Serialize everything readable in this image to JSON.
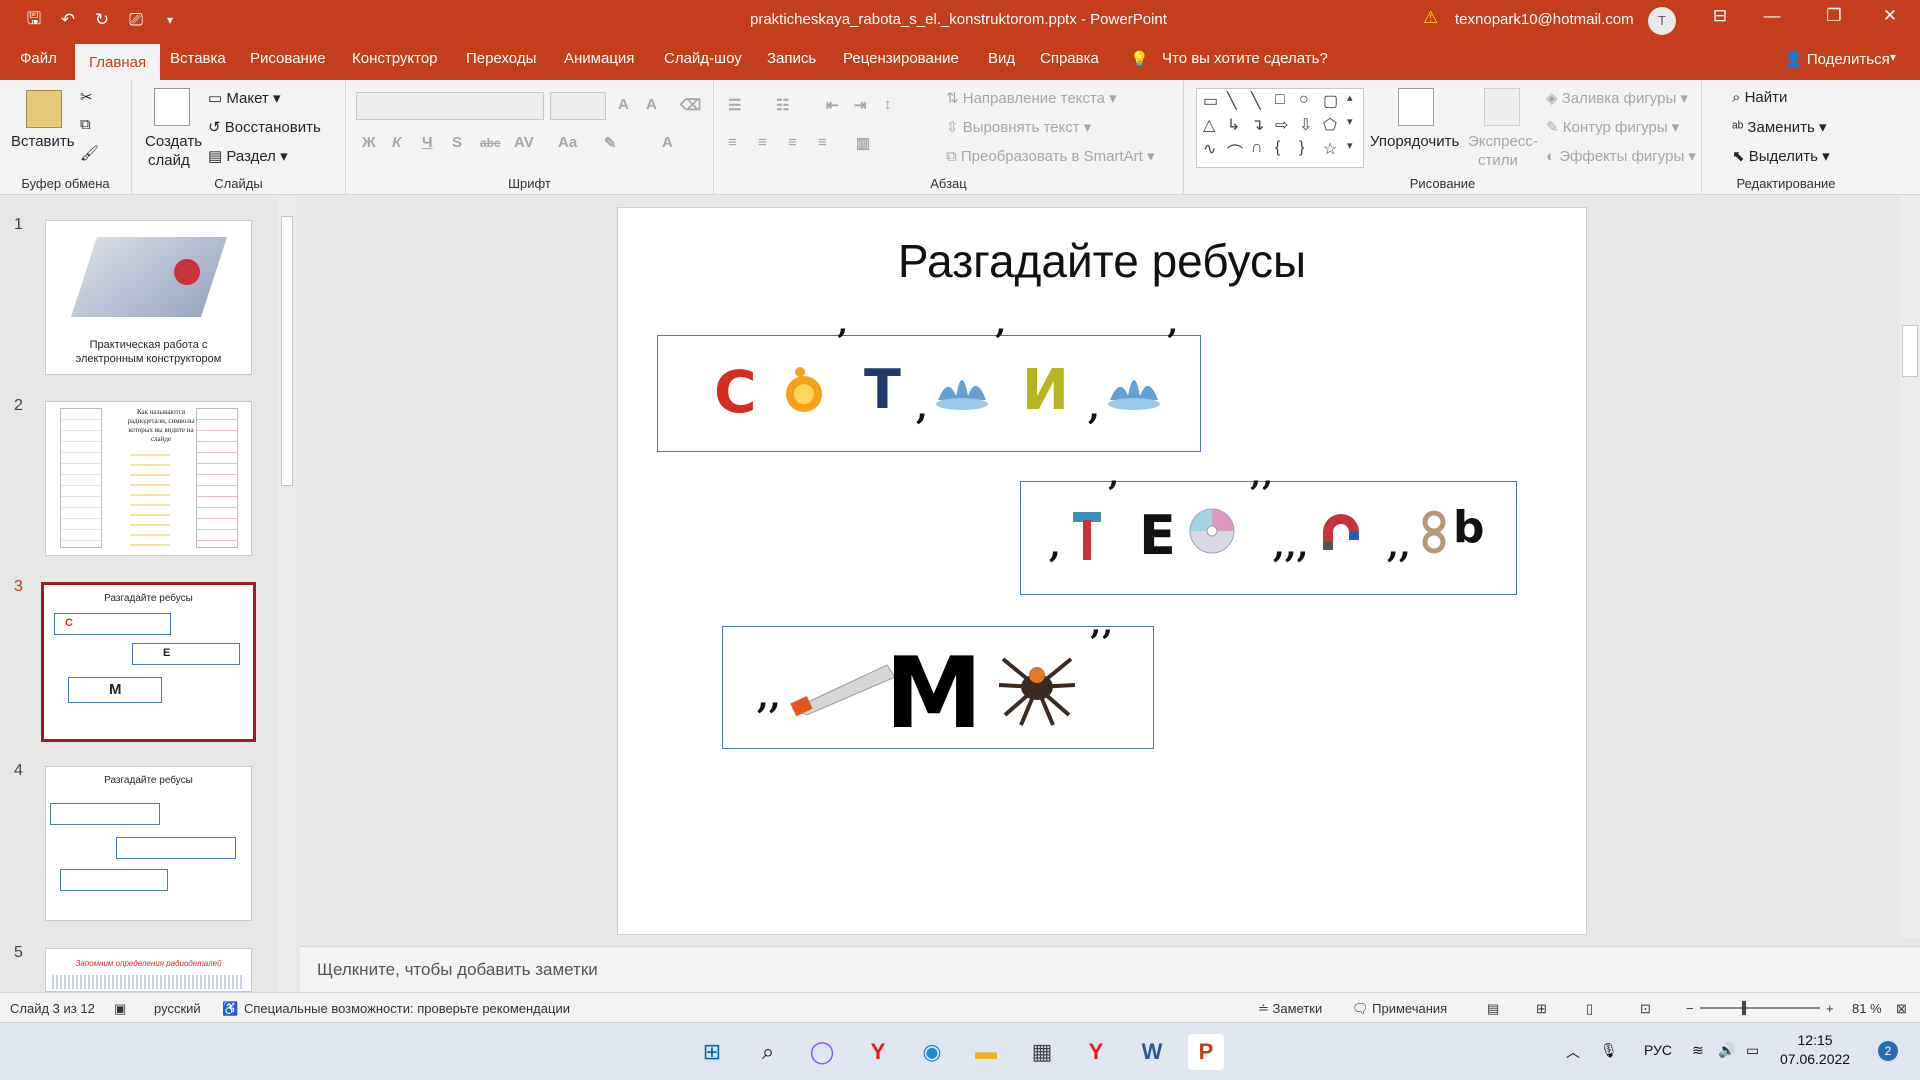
{
  "window": {
    "title": "prakticheskaya_rabota_s_el._konstruktorom.pptx - PowerPoint",
    "account": "texnopark10@hotmail.com",
    "avatar_letter": "T",
    "accent": "#c43e1c"
  },
  "tabs": [
    "Файл",
    "Главная",
    "Вставка",
    "Рисование",
    "Конструктор",
    "Переходы",
    "Анимация",
    "Слайд-шоу",
    "Запись",
    "Рецензирование",
    "Вид",
    "Справка"
  ],
  "active_tab": "Главная",
  "tell_me": "Что вы хотите сделать?",
  "share": "Поделиться",
  "ribbon": {
    "clipboard": {
      "paste": "Вставить",
      "label": "Буфер обмена"
    },
    "slides": {
      "new_slide_1": "Создать",
      "new_slide_2": "слайд",
      "layout": "Макет",
      "reset": "Восстановить",
      "section": "Раздел",
      "label": "Слайды"
    },
    "font": {
      "label": "Шрифт",
      "buttons": [
        "Ж",
        "К",
        "Ч",
        "S",
        "abc",
        "AV",
        "Aa",
        "A"
      ]
    },
    "paragraph": {
      "text_direction": "Направление текста",
      "align_text": "Выровнять текст",
      "smartart": "Преобразовать в SmartArt",
      "label": "Абзац"
    },
    "drawing": {
      "arrange": "Упорядочить",
      "quick_styles_1": "Экспресс-",
      "quick_styles_2": "стили",
      "fill": "Заливка фигуры",
      "outline": "Контур фигуры",
      "effects": "Эффекты фигуры",
      "label": "Рисование"
    },
    "editing": {
      "find": "Найти",
      "replace": "Заменить",
      "select": "Выделить",
      "label": "Редактирование"
    }
  },
  "thumbnails": [
    {
      "num": "1",
      "caption_1": "Практическая работа с",
      "caption_2": "электронным конструктором"
    },
    {
      "num": "2",
      "heading": "Как называются радиодетали, символы которых вы видите на слайде"
    },
    {
      "num": "3",
      "heading": "Разгадайте ребусы"
    },
    {
      "num": "4",
      "heading": "Разгадайте ребусы"
    },
    {
      "num": "5",
      "heading": "Запомним определения радиодеталей"
    }
  ],
  "slide": {
    "title": "Разгадайте ребусы",
    "rebus1": {
      "letters": [
        "С",
        "Т",
        "И"
      ],
      "commas": [
        "’",
        "’",
        ",",
        "’",
        ",",
        "’"
      ]
    },
    "rebus2": {
      "letters": [
        "Е",
        "b"
      ],
      "commas": [
        ",",
        "’",
        "’’",
        ",,,",
        ",,"
      ]
    },
    "rebus3": {
      "letters": [
        "М"
      ],
      "commas": [
        ",,",
        "’’"
      ]
    }
  },
  "notes_placeholder": "Щелкните, чтобы добавить заметки",
  "status": {
    "slide_of": "Слайд 3 из 12",
    "language": "русский",
    "accessibility": "Специальные возможности: проверьте рекомендации",
    "notes": "Заметки",
    "comments": "Примечания",
    "zoom": "81 %"
  },
  "taskbar": {
    "time": "12:15",
    "date": "07.06.2022",
    "lang": "РУС",
    "notifications": "2"
  }
}
